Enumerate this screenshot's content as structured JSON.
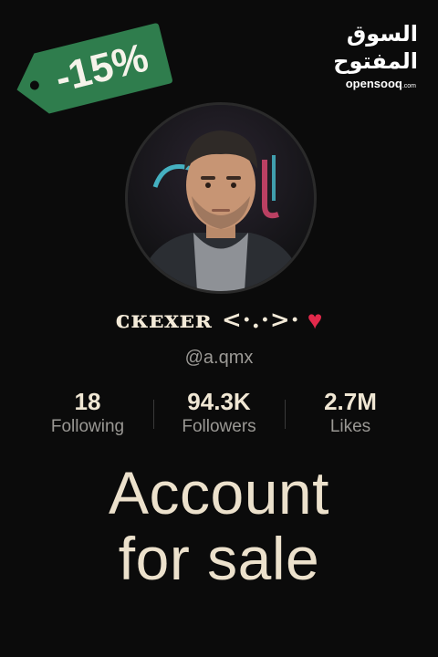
{
  "discount_tag": {
    "label": "-15%",
    "color": "#2f7d4d"
  },
  "logo": {
    "arabic": "السوق المفتوح",
    "latin": "opensooq",
    "suffix": ".com"
  },
  "avatar": {
    "icon": "profile-photo"
  },
  "profile": {
    "display_name": "ᴄᴋᴇxᴇʀ <·.·>·",
    "heart": "♥",
    "handle": "@a.qmx"
  },
  "stats": [
    {
      "value": "18",
      "label": "Following"
    },
    {
      "value": "94.3K",
      "label": "Followers"
    },
    {
      "value": "2.7M",
      "label": "Likes"
    }
  ],
  "headline": {
    "line1": "Account",
    "line2": "for sale"
  },
  "colors": {
    "background": "#0b0b0b",
    "heart": "#e3294b",
    "text": "#ece1cc"
  }
}
